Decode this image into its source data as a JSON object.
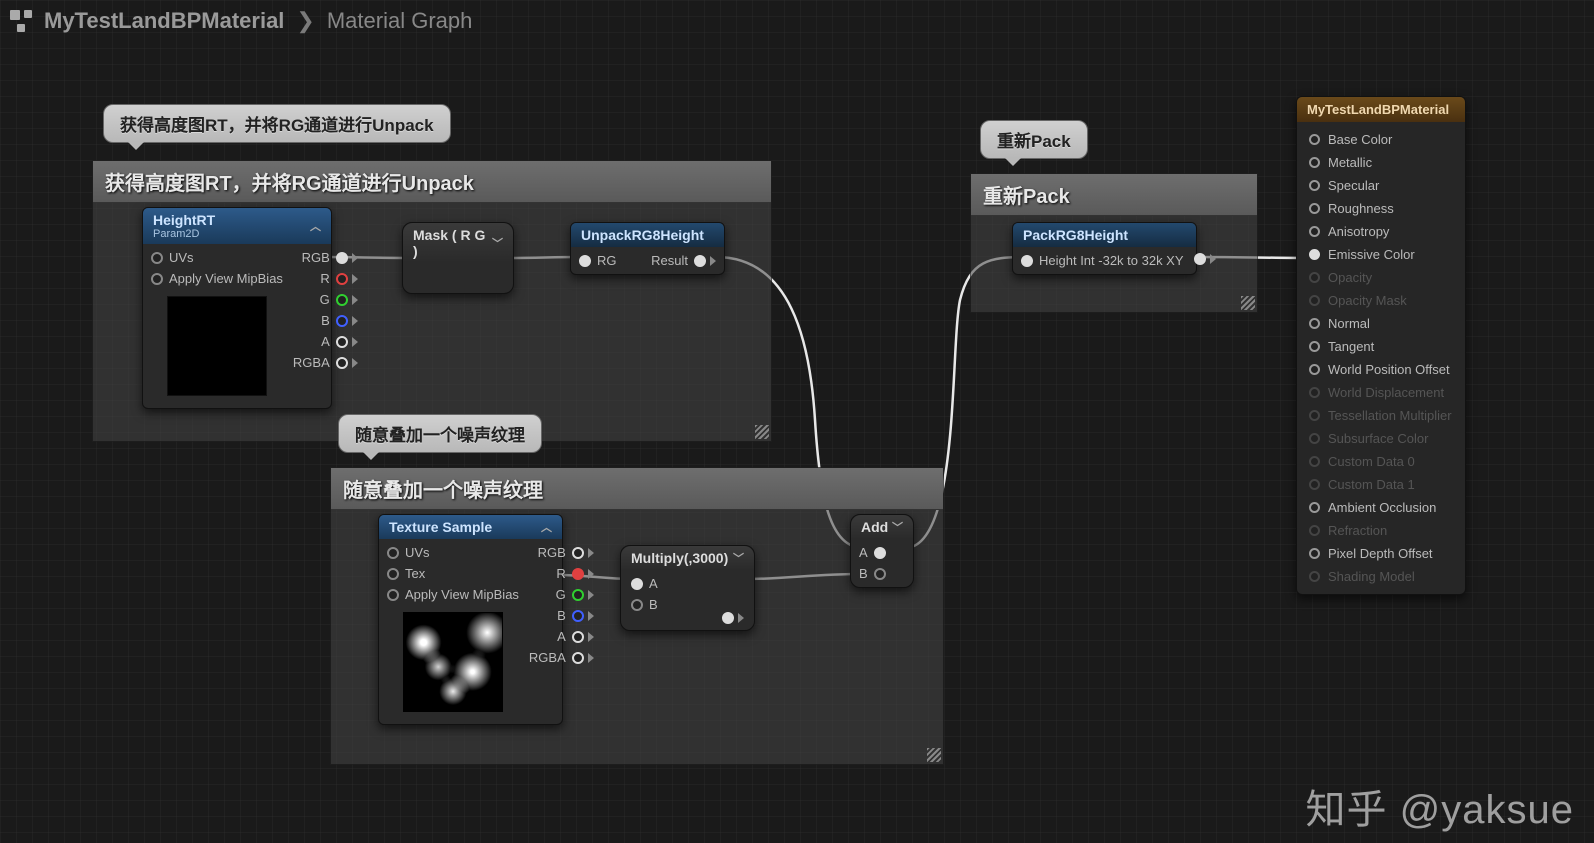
{
  "breadcrumb": {
    "item1": "MyTestLandBPMaterial",
    "sep": "❯",
    "item2": "Material Graph"
  },
  "bubbles": {
    "b1": "获得高度图RT，并将RG通道进行Unpack",
    "b2": "随意叠加一个噪声纹理",
    "b3": "重新Pack"
  },
  "groups": {
    "g1": "获得高度图RT，并将RG通道进行Unpack",
    "g2": "随意叠加一个噪声纹理",
    "g3": "重新Pack"
  },
  "nodes": {
    "heightRT": {
      "title": "HeightRT",
      "subtitle": "Param2D",
      "in": [
        "UVs",
        "Apply View MipBias"
      ],
      "out": [
        "RGB",
        "R",
        "G",
        "B",
        "A",
        "RGBA"
      ]
    },
    "mask": {
      "title": "Mask ( R G )"
    },
    "unpack": {
      "title": "UnpackRG8Height",
      "in": "RG",
      "out": "Result"
    },
    "texSample": {
      "title": "Texture Sample",
      "in": [
        "UVs",
        "Tex",
        "Apply View MipBias"
      ],
      "out": [
        "RGB",
        "R",
        "G",
        "B",
        "A",
        "RGBA"
      ]
    },
    "multiply": {
      "title": "Multiply(,3000)",
      "inA": "A",
      "inB": "B"
    },
    "add": {
      "title": "Add",
      "inA": "A",
      "inB": "B"
    },
    "pack": {
      "title": "PackRG8Height",
      "in": "Height Int -32k to 32k XY"
    }
  },
  "materialOutput": {
    "title": "MyTestLandBPMaterial",
    "pins": [
      {
        "label": "Base Color",
        "enabled": true
      },
      {
        "label": "Metallic",
        "enabled": true
      },
      {
        "label": "Specular",
        "enabled": true
      },
      {
        "label": "Roughness",
        "enabled": true
      },
      {
        "label": "Anisotropy",
        "enabled": true
      },
      {
        "label": "Emissive Color",
        "enabled": true,
        "connected": true
      },
      {
        "label": "Opacity",
        "enabled": false
      },
      {
        "label": "Opacity Mask",
        "enabled": false
      },
      {
        "label": "Normal",
        "enabled": true
      },
      {
        "label": "Tangent",
        "enabled": true
      },
      {
        "label": "World Position Offset",
        "enabled": true
      },
      {
        "label": "World Displacement",
        "enabled": false
      },
      {
        "label": "Tessellation Multiplier",
        "enabled": false
      },
      {
        "label": "Subsurface Color",
        "enabled": false
      },
      {
        "label": "Custom Data 0",
        "enabled": false
      },
      {
        "label": "Custom Data 1",
        "enabled": false
      },
      {
        "label": "Ambient Occlusion",
        "enabled": true
      },
      {
        "label": "Refraction",
        "enabled": false
      },
      {
        "label": "Pixel Depth Offset",
        "enabled": true
      },
      {
        "label": "Shading Model",
        "enabled": false
      }
    ]
  },
  "watermark": "知乎 @yaksue"
}
